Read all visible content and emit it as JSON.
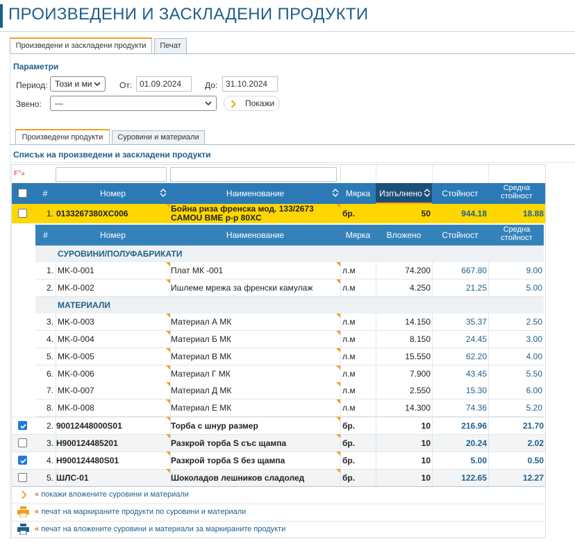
{
  "page": {
    "title": "ПРОИЗВЕДЕНИ И ЗАСКЛАДЕНИ ПРОДУКТИ"
  },
  "top_tabs": [
    {
      "label": "Произведени и заскладени продукти",
      "active": true
    },
    {
      "label": "Печат",
      "active": false
    }
  ],
  "params": {
    "title": "Параметри",
    "period_label": "Период:",
    "period_value": "Този и ми",
    "from_label": "От:",
    "from_value": "01.09.2024",
    "to_label": "До:",
    "to_value": "31.10.2024",
    "unit_label": "Звено:",
    "unit_value": "---",
    "show_button": "Покажи"
  },
  "sub_tabs": [
    {
      "label": "Произведени продукти",
      "active": true
    },
    {
      "label": "Суровини и материали",
      "active": false
    }
  ],
  "list_title": "Списък на произведени и заскладени продукти",
  "filter_label": "F°»",
  "columns": {
    "num": "#",
    "code": "Номер",
    "name": "Наименование",
    "unit": "Мярка",
    "done": "Изпълнено",
    "cost": "Стойност",
    "avg": "Средна стойност"
  },
  "sub_columns": {
    "num": "#",
    "code": "Номер",
    "name": "Наименование",
    "unit": "Мярка",
    "used": "Вложено",
    "cost": "Стойност",
    "avg": "Средна стойност"
  },
  "products": [
    {
      "n": "1.",
      "code": "0133267380XC006",
      "name": "Бойна риза френска мод. 133/2673 CAMOU ВМЕ р-р 80XC",
      "unit": "бр.",
      "done": "50",
      "cost": "944.18",
      "avg": "18.88",
      "checked": false,
      "expanded": true
    },
    {
      "n": "2.",
      "code": "90012448000S01",
      "name": "Торба с шнур размер",
      "unit": "бр.",
      "done": "10",
      "cost": "216.96",
      "avg": "21.70",
      "checked": true
    },
    {
      "n": "3.",
      "code": "H900124485201",
      "name": "Разкрой торба S със щампа",
      "unit": "бр.",
      "done": "10",
      "cost": "20.24",
      "avg": "2.02",
      "checked": false
    },
    {
      "n": "4.",
      "code": "H900124480S01",
      "name": "Разкрой торба S без щампа",
      "unit": "бр.",
      "done": "10",
      "cost": "5.00",
      "avg": "0.50",
      "checked": true
    },
    {
      "n": "5.",
      "code": "ШЛС-01",
      "name": "Шоколадов лешников сладолед",
      "unit": "бр.",
      "done": "10",
      "cost": "122.65",
      "avg": "12.27",
      "checked": false
    }
  ],
  "groups": [
    {
      "title": "СУРОВИНИ/ПОЛУФАБРИКАТИ"
    },
    {
      "title": "МАТЕРИАЛИ"
    }
  ],
  "materials": [
    {
      "n": "1.",
      "code": "MK-0-001",
      "name": "Плат МК -001",
      "unit": "л.м",
      "used": "74.200",
      "cost": "667.80",
      "avg": "9.00"
    },
    {
      "n": "2.",
      "code": "MK-0-002",
      "name": "Ишлеме мрежа за френски камулаж",
      "unit": "л.м",
      "used": "4.250",
      "cost": "21.25",
      "avg": "5.00"
    },
    {
      "n": "3.",
      "code": "MK-0-003",
      "name": "Материал А МК",
      "unit": "л.м",
      "used": "14.150",
      "cost": "35.37",
      "avg": "2.50"
    },
    {
      "n": "4.",
      "code": "MK-0-004",
      "name": "Материал Б МК",
      "unit": "л.м",
      "used": "8.150",
      "cost": "24.45",
      "avg": "3.00"
    },
    {
      "n": "5.",
      "code": "MK-0-005",
      "name": "Материал В МК",
      "unit": "л.м",
      "used": "15.550",
      "cost": "62.20",
      "avg": "4.00"
    },
    {
      "n": "6.",
      "code": "MK-0-006",
      "name": "Материал Г МК",
      "unit": "л.м",
      "used": "7.900",
      "cost": "43.45",
      "avg": "5.50"
    },
    {
      "n": "7.",
      "code": "MK-0-007",
      "name": "Материал Д МК",
      "unit": "л.м",
      "used": "2.550",
      "cost": "15.30",
      "avg": "6.00"
    },
    {
      "n": "8.",
      "code": "MK-0-008",
      "name": "Материал Е МК",
      "unit": "л.м",
      "used": "14.300",
      "cost": "74.36",
      "avg": "5.20"
    }
  ],
  "links": [
    {
      "text": "покажи вложените суровини и материали",
      "icon": "chevron-right-icon"
    },
    {
      "text": "печат на маркираните продукти по суровини и материали",
      "icon": "printer-orange-icon"
    },
    {
      "text": "печат на вложените суровини и материали за маркираните продукти",
      "icon": "printer-blue-icon"
    }
  ],
  "colors": {
    "brand": "#1f5f8b",
    "header": "#2b7ab5",
    "highlight": "#ffd700",
    "accent": "#f0a020",
    "check": "#1f7ae0"
  }
}
